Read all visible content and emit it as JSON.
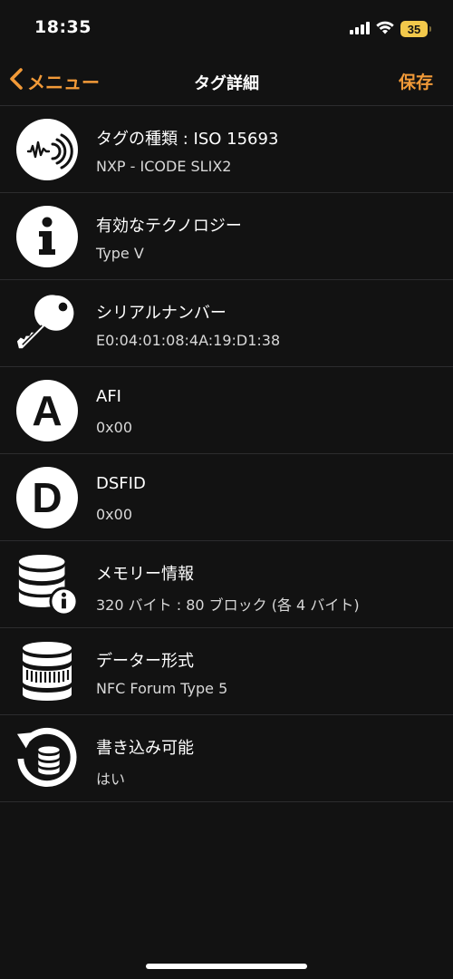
{
  "status": {
    "time": "18:35",
    "battery": "35"
  },
  "nav": {
    "back_label": "メニュー",
    "title": "タグ詳細",
    "save_label": "保存"
  },
  "accent_color": "#f29a38",
  "items": [
    {
      "icon": "nfc-sound-wave-icon",
      "title": "タグの種類 : ISO 15693",
      "subtitle": "NXP - ICODE SLIX2"
    },
    {
      "icon": "info-icon",
      "title": "有効なテクノロジー",
      "subtitle": "Type V"
    },
    {
      "icon": "key-icon",
      "title": "シリアルナンバー",
      "subtitle": "E0:04:01:08:4A:19:D1:38"
    },
    {
      "icon": "letter-a-icon",
      "icon_letter": "A",
      "title": "AFI",
      "subtitle": "0x00"
    },
    {
      "icon": "letter-d-icon",
      "icon_letter": "D",
      "title": "DSFID",
      "subtitle": "0x00"
    },
    {
      "icon": "database-info-icon",
      "title": "メモリー情報",
      "subtitle": "320 バイト : 80 ブロック (各 4 バイト)"
    },
    {
      "icon": "database-format-icon",
      "title": "データー形式",
      "subtitle": "NFC Forum Type 5"
    },
    {
      "icon": "database-rewrite-icon",
      "title": "書き込み可能",
      "subtitle": "はい"
    }
  ]
}
